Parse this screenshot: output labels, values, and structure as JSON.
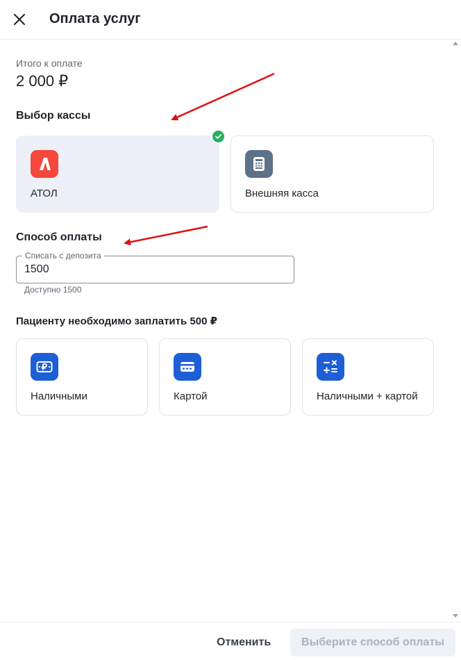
{
  "header": {
    "title": "Оплата услуг",
    "close_icon": "close-icon"
  },
  "total": {
    "label": "Итого к оплате",
    "amount": "2 000 ₽"
  },
  "cashbox": {
    "title": "Выбор кассы",
    "options": [
      {
        "label": "АТОЛ",
        "icon": "atol-logo-icon",
        "icon_color": "#f5473b",
        "selected": true
      },
      {
        "label": "Внешняя касса",
        "icon": "cash-register-icon",
        "icon_color": "#5d7188",
        "selected": false
      }
    ]
  },
  "payment": {
    "title": "Способ оплаты",
    "deposit_field": {
      "label": "Списать с депозита",
      "value": "1500",
      "helper": "Доступно 1500"
    },
    "patient_note": "Пациенту необходимо заплатить 500 ₽",
    "methods": [
      {
        "label": "Наличными",
        "icon": "cash-icon",
        "icon_color": "#1e5fd6"
      },
      {
        "label": "Картой",
        "icon": "card-icon",
        "icon_color": "#1e5fd6"
      },
      {
        "label": "Наличными + картой",
        "icon": "calculator-icon",
        "icon_color": "#1e5fd6"
      }
    ]
  },
  "footer": {
    "cancel_label": "Отменить",
    "submit_label": "Выберите способ оплаты"
  },
  "colors": {
    "accent": "#1e5fd6",
    "selected_bg": "#edf0f8",
    "check": "#27ae60",
    "arrow": "#e01010"
  }
}
